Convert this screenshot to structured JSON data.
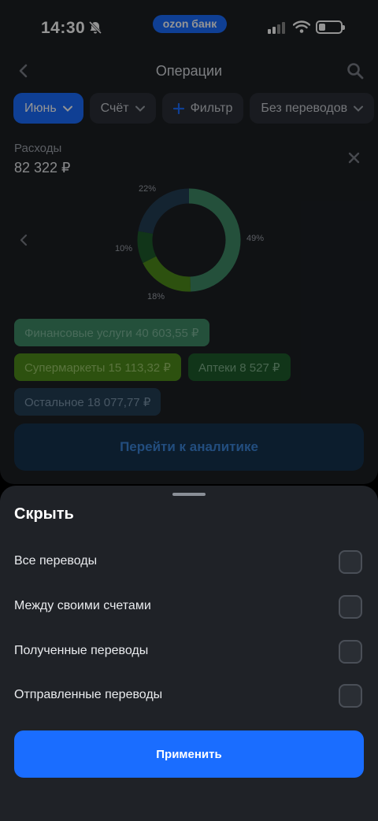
{
  "status": {
    "time": "14:30",
    "brand": "ozon банк"
  },
  "header": {
    "title": "Операции"
  },
  "chips": [
    {
      "label": "Июнь",
      "active": true
    },
    {
      "label": "Счёт"
    },
    {
      "label": "Фильтр"
    },
    {
      "label": "Без переводов"
    }
  ],
  "expenses": {
    "label": "Расходы",
    "value": "82 322 ₽"
  },
  "chart_data": {
    "type": "pie",
    "donut": true,
    "labels": [
      "Финансовые услуги",
      "Супермаркеты",
      "Аптеки",
      "Остальное"
    ],
    "values": [
      49,
      18,
      10,
      22
    ],
    "value_labels": [
      "49%",
      "18%",
      "10%",
      "22%"
    ],
    "colors": [
      "#3e8b66",
      "#4f8c1b",
      "#1e5c2c",
      "#243f55"
    ]
  },
  "tags": [
    {
      "label": "Финансовые услуги 40 603,55 ₽",
      "bg": "#3e8b66",
      "color": "#7fb89c"
    },
    {
      "label": "Супермаркеты 15 113,32 ₽",
      "bg": "#4f8c1b",
      "color": "#9cc86b"
    },
    {
      "label": "Аптеки 8 527 ₽",
      "bg": "#1e5c2c",
      "color": "#7fb08a"
    },
    {
      "label": "Остальное 18 077,77 ₽",
      "bg": "#243f55",
      "color": "#7d97ad"
    }
  ],
  "cta_label": "Перейти к аналитике",
  "sheet": {
    "title": "Скрыть",
    "options": [
      {
        "label": "Все переводы",
        "checked": false
      },
      {
        "label": "Между своими счетами",
        "checked": false
      },
      {
        "label": "Полученные переводы",
        "checked": false
      },
      {
        "label": "Отправленные переводы",
        "checked": false
      }
    ],
    "apply_label": "Применить"
  },
  "colors": {
    "accent": "#1a6dff",
    "sheet_bg": "#1f2227",
    "screen_bg": "#1c1f24"
  }
}
